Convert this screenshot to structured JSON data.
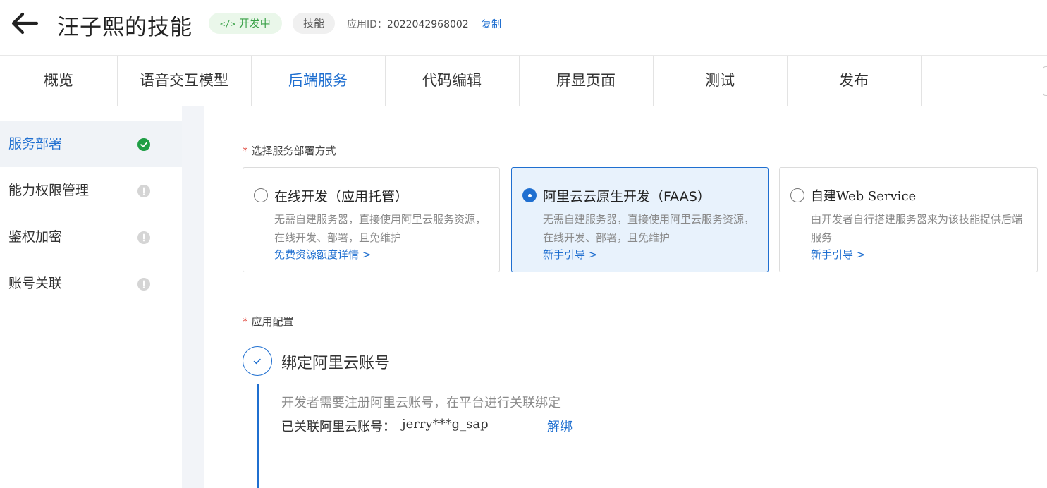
{
  "header": {
    "title": "汪子熙的技能",
    "status_badge": "开发中",
    "status_icon": "</>",
    "type_badge": "技能",
    "app_id_label": "应用ID：",
    "app_id_value": "2022042968002",
    "copy_label": "复制"
  },
  "tabs": [
    {
      "label": "概览",
      "active": false
    },
    {
      "label": "语音交互模型",
      "active": false
    },
    {
      "label": "后端服务",
      "active": true
    },
    {
      "label": "代码编辑",
      "active": false
    },
    {
      "label": "屏显页面",
      "active": false
    },
    {
      "label": "测试",
      "active": false
    },
    {
      "label": "发布",
      "active": false
    }
  ],
  "sidebar": {
    "items": [
      {
        "label": "服务部署",
        "status": "ok",
        "active": true
      },
      {
        "label": "能力权限管理",
        "status": "warn",
        "active": false
      },
      {
        "label": "鉴权加密",
        "status": "warn",
        "active": false
      },
      {
        "label": "账号关联",
        "status": "warn",
        "active": false
      }
    ]
  },
  "deploy": {
    "section_label": "选择服务部署方式",
    "required_mark": "*",
    "options": [
      {
        "title": "在线开发（应用托管）",
        "desc": "无需自建服务器，直接使用阿里云服务资源，在线开发、部署，且免维护",
        "link": "免费资源额度详情 >",
        "selected": false
      },
      {
        "title": "阿里云云原生开发（FAAS）",
        "desc": "无需自建服务器，直接使用阿里云服务资源，在线开发、部署，且免维护",
        "link": "新手引导 >",
        "selected": true
      },
      {
        "title": "自建Web Service",
        "desc": "由开发者自行搭建服务器来为该技能提供后端服务",
        "link": "新手引导 >",
        "selected": false
      }
    ]
  },
  "config": {
    "section_label": "应用配置",
    "required_mark": "*",
    "step_title": "绑定阿里云账号",
    "step_desc": "开发者需要注册阿里云账号，在平台进行关联绑定",
    "linked_label": "已关联阿里云账号：",
    "linked_value": "jerry***g_sap",
    "unbind_label": "解绑"
  },
  "colors": {
    "accent": "#1f6fd0",
    "success": "#1f9e45",
    "required": "#e0453a"
  }
}
